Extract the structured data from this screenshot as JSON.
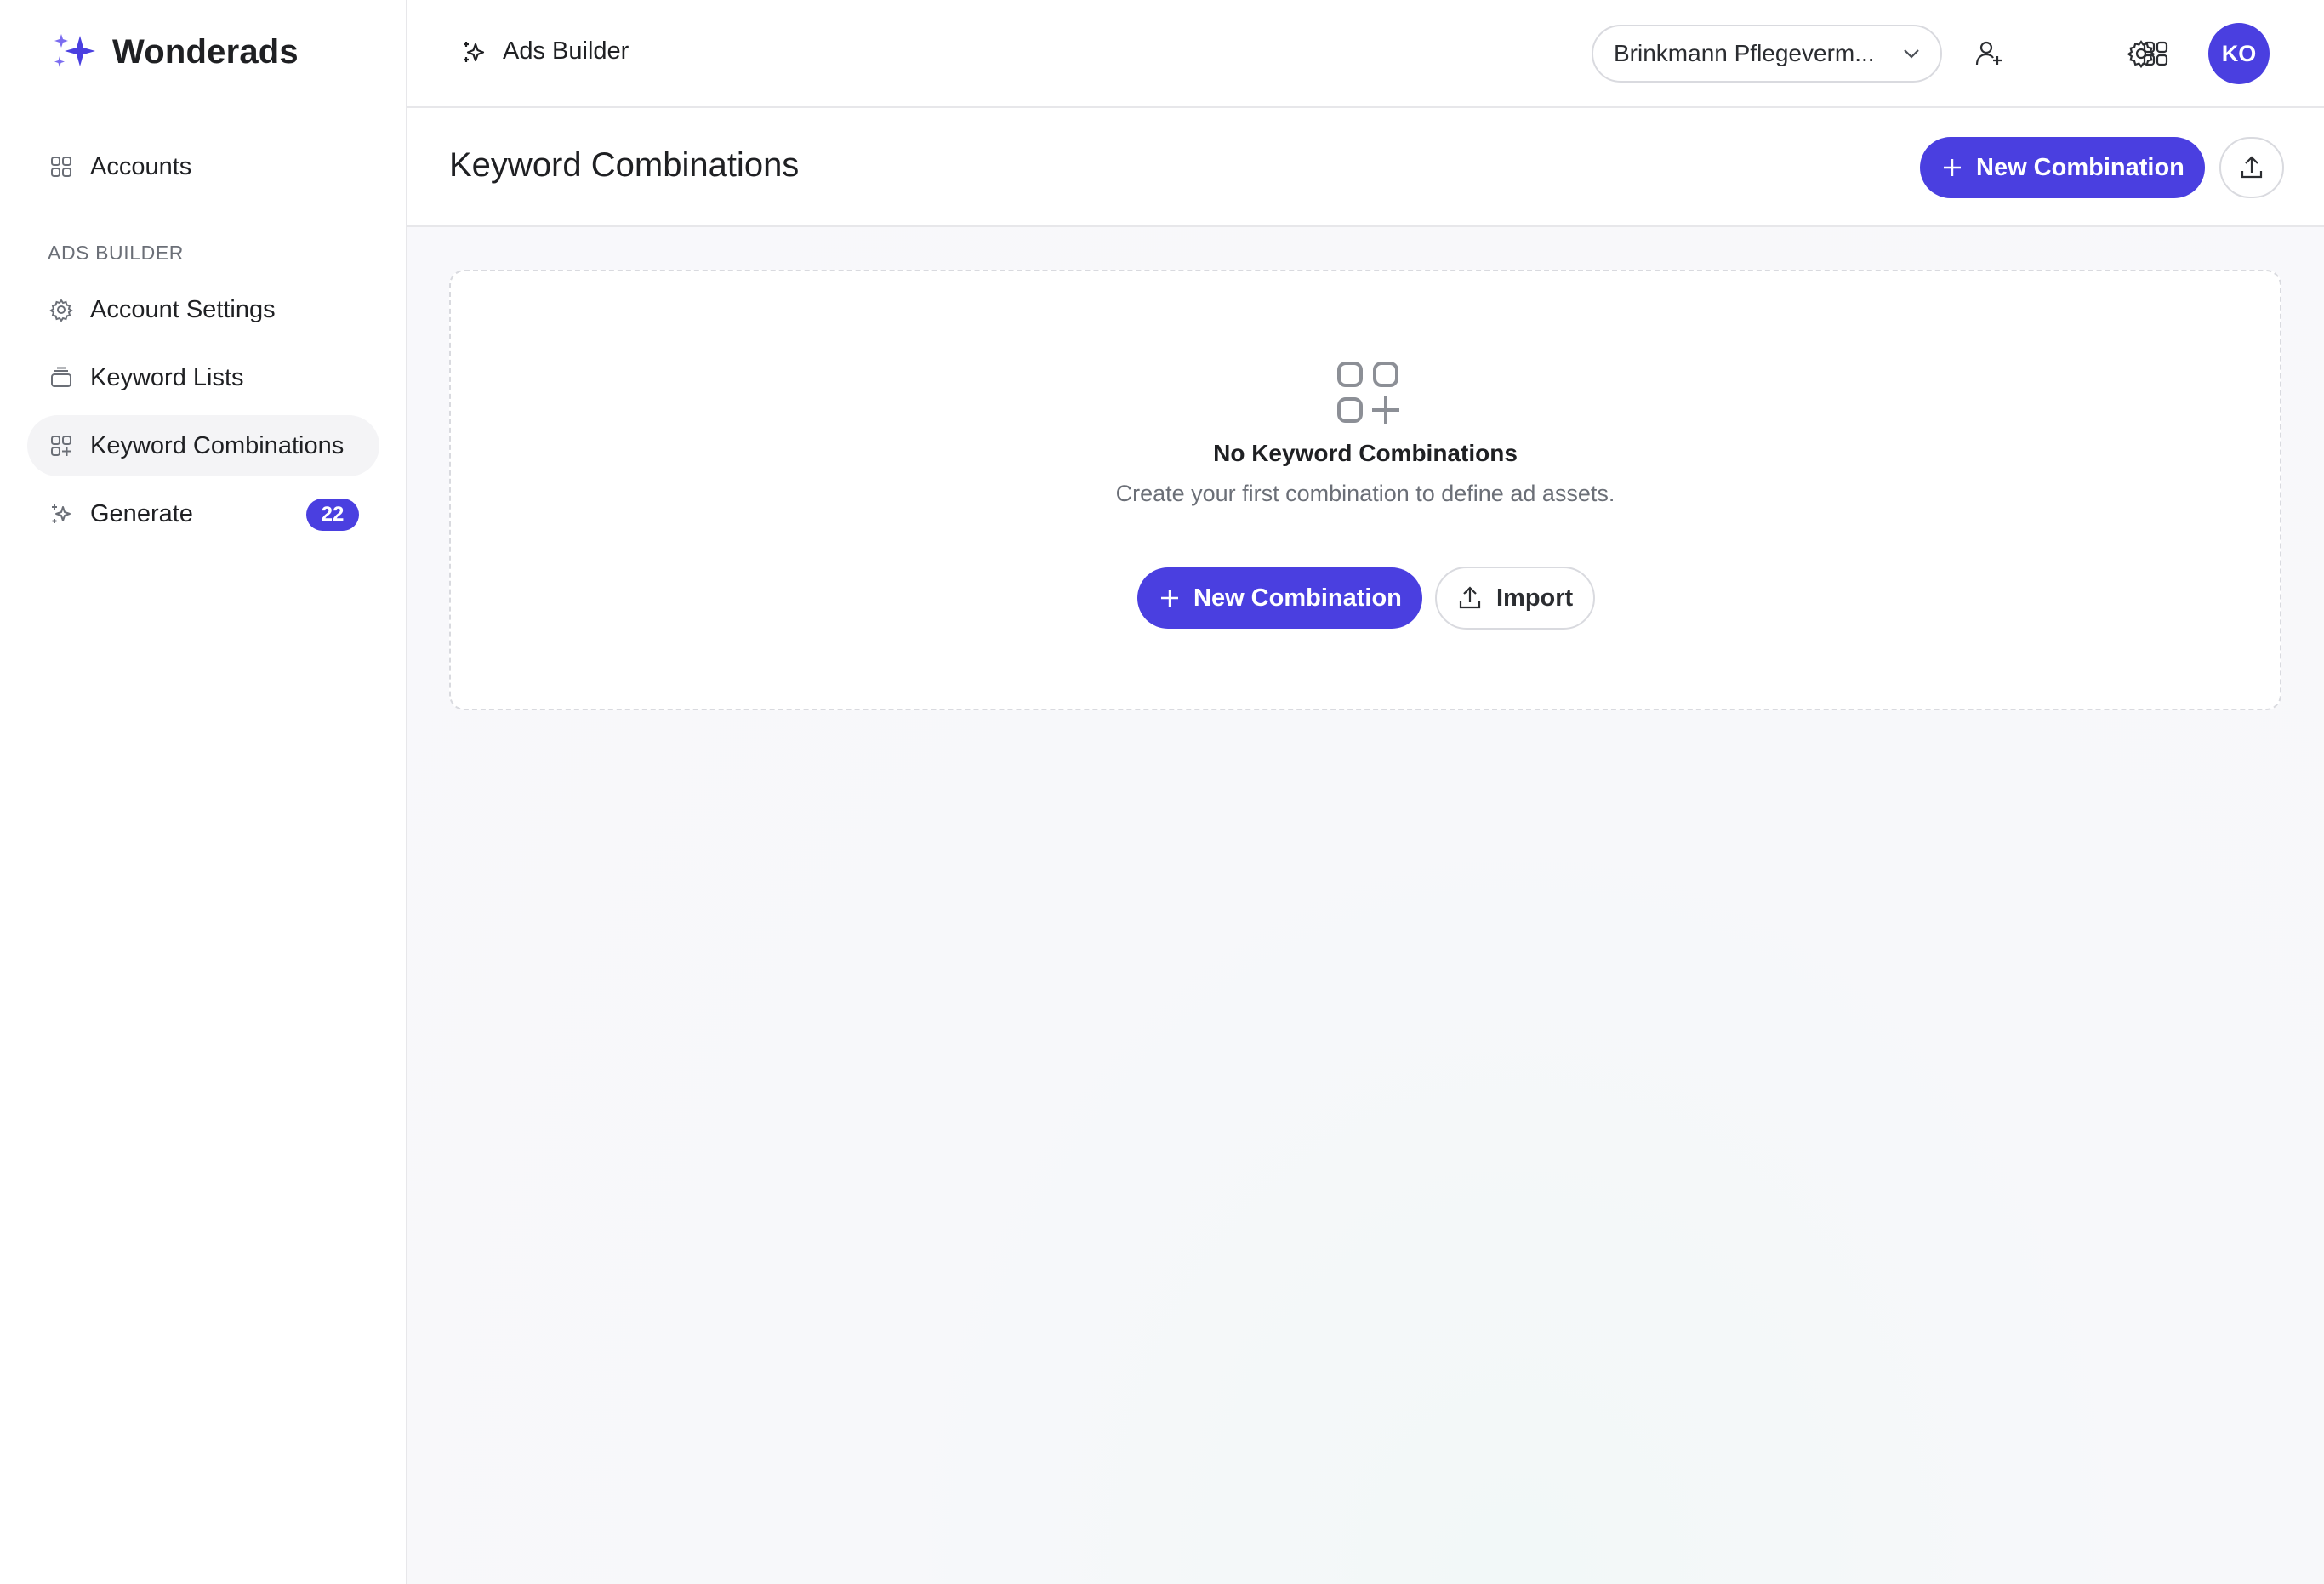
{
  "brand": {
    "name": "Wonderads",
    "accent": "#4a3fe0"
  },
  "sidebar": {
    "top_item": {
      "label": "Accounts",
      "icon": "grid-icon"
    },
    "section_label": "ADS BUILDER",
    "items": [
      {
        "label": "Account Settings",
        "icon": "gear-icon"
      },
      {
        "label": "Keyword Lists",
        "icon": "stack-icon"
      },
      {
        "label": "Keyword Combinations",
        "icon": "grid-plus-icon",
        "active": true
      },
      {
        "label": "Generate",
        "icon": "sparkle-icon",
        "badge": "22"
      }
    ]
  },
  "topbar": {
    "title": "Ads Builder",
    "account_select": "Brinkmann Pflegeverm...",
    "avatar_initials": "KO"
  },
  "page": {
    "title": "Keyword Combinations",
    "new_button_label": "New Combination"
  },
  "empty_state": {
    "title": "No Keyword Combinations",
    "subtitle": "Create your first combination to define ad assets.",
    "new_button_label": "New Combination",
    "import_button_label": "Import"
  }
}
